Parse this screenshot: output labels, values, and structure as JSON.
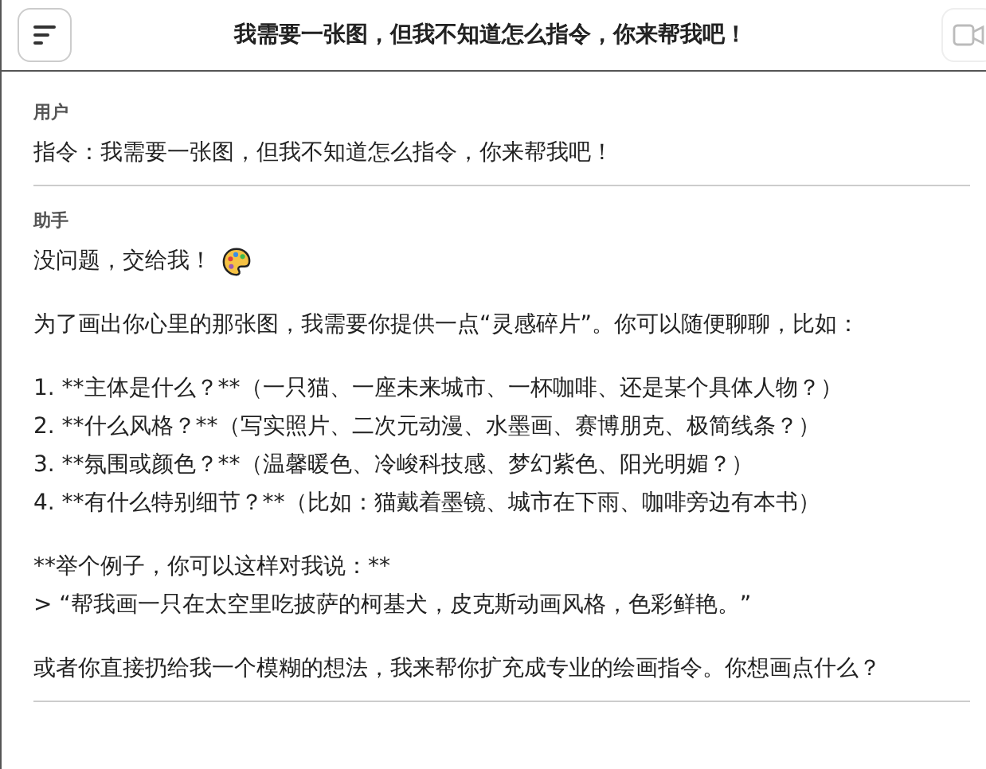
{
  "header": {
    "title": "我需要一张图，但我不知道怎么指令，你来帮我吧！"
  },
  "messages": [
    {
      "role": "用户",
      "paragraphs": [
        {
          "lines": [
            "指令：我需要一张图，但我不知道怎么指令，你来帮我吧！"
          ]
        }
      ]
    },
    {
      "role": "助手",
      "paragraphs": [
        {
          "lines": [
            "没问题，交给我！"
          ],
          "kind": "with-emoji"
        },
        {
          "lines": [
            "为了画出你心里的那张图，我需要你提供一点“灵感碎片”。你可以随便聊聊，比如："
          ]
        },
        {
          "lines": [
            "1. **主体是什么？**（一只猫、一座未来城市、一杯咖啡、还是某个具体人物？）",
            "2. **什么风格？**（写实照片、二次元动漫、水墨画、赛博朋克、极简线条？）",
            "3. **氛围或颜色？**（温馨暖色、冷峻科技感、梦幻紫色、阳光明媚？）",
            "4. **有什么特别细节？**（比如：猫戴着墨镜、城市在下雨、咖啡旁边有本书）"
          ]
        },
        {
          "lines": [
            "**举个例子，你可以这样对我说：**",
            "> “帮我画一只在太空里吃披萨的柯基犬，皮克斯动画风格，色彩鲜艳。”"
          ]
        },
        {
          "lines": [
            "或者你直接扔给我一个模糊的想法，我来帮你扩充成专业的绘画指令。你想画点什么？"
          ]
        }
      ]
    }
  ]
}
